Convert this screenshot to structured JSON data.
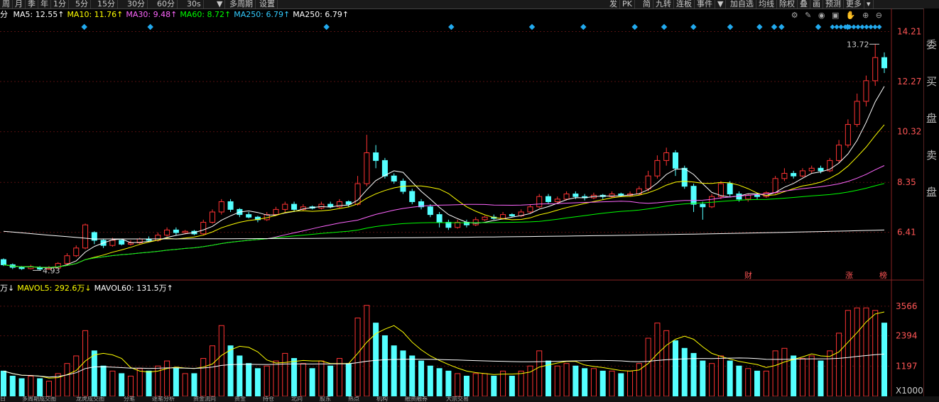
{
  "toolbar": {
    "left_buttons": [
      "周",
      "月",
      "季",
      "年",
      "1分",
      "5分",
      "15分",
      "30分",
      "60分",
      "30s",
      "▼",
      "多周期",
      "设置"
    ],
    "right_buttons": [
      "发",
      "PK",
      "简",
      "九转",
      "连板",
      "事件",
      "▼",
      "加自选",
      "均线",
      "除权",
      "叠",
      "画",
      "预测",
      "更多",
      "▾"
    ]
  },
  "ma_legend": {
    "prefix": "分",
    "items": [
      {
        "label": "MA5: 12.55↑",
        "color": "#ffffff"
      },
      {
        "label": "MA10: 11.76↑",
        "color": "#ffff00"
      },
      {
        "label": "MA30: 9.48↑",
        "color": "#ff66ff"
      },
      {
        "label": "MA60: 8.72↑",
        "color": "#00ff00"
      },
      {
        "label": "MA250: 6.79↑",
        "color": "#33ccff"
      },
      {
        "label": "MA250: 6.79↑",
        "color": "#ffffff"
      }
    ]
  },
  "vol_legend": {
    "items": [
      {
        "label": "万↓",
        "color": "#ffffff"
      },
      {
        "label": "MAVOL5: 292.6万↓",
        "color": "#ffff00"
      },
      {
        "label": "MAVOL60: 131.5万↑",
        "color": "#ffffff"
      }
    ]
  },
  "price_axis": [
    "14.21",
    "12.27",
    "10.32",
    "8.35",
    "6.41"
  ],
  "volume_axis": [
    "3566",
    "2394",
    "1197",
    "X1000"
  ],
  "annotations": {
    "high": "13.72",
    "low": "4.93",
    "events": [
      "财",
      "涨",
      "榜"
    ]
  },
  "side_panel": [
    "委",
    "买",
    "盘",
    "卖",
    "盘"
  ],
  "bottom_tabs": [
    "日",
    "多周期成交图",
    "龙虎成交图",
    "分笔",
    "逐笔分析",
    "资金流向",
    "资金",
    "持仓",
    "北向",
    "股东",
    "热点",
    "机构",
    "融资融券",
    "大宗交易"
  ],
  "chart_data": {
    "type": "candlestick",
    "price_range": [
      4.5,
      14.5
    ],
    "volume_max": 3900,
    "candles": [
      [
        5.35,
        5.15,
        5.4,
        5.1,
        1
      ],
      [
        5.15,
        5.05,
        5.2,
        4.98,
        0.8
      ],
      [
        5.05,
        5.0,
        5.1,
        4.95,
        0.7
      ],
      [
        5.0,
        5.08,
        5.15,
        4.97,
        0.8
      ],
      [
        5.05,
        4.98,
        5.1,
        4.93,
        0.7
      ],
      [
        4.98,
        5.02,
        5.1,
        4.95,
        0.6
      ],
      [
        5.02,
        5.2,
        5.25,
        5.0,
        0.9
      ],
      [
        5.2,
        5.5,
        5.6,
        5.15,
        1.3
      ],
      [
        5.5,
        5.8,
        5.9,
        5.45,
        1.6
      ],
      [
        5.8,
        6.7,
        6.75,
        5.75,
        2.6
      ],
      [
        6.4,
        6.1,
        6.45,
        5.95,
        1.8
      ],
      [
        6.1,
        5.9,
        6.15,
        5.8,
        1.2
      ],
      [
        5.9,
        6.1,
        6.2,
        5.85,
        1.0
      ],
      [
        6.1,
        5.95,
        6.15,
        5.9,
        0.9
      ],
      [
        5.95,
        6.0,
        6.1,
        5.9,
        0.8
      ],
      [
        6.0,
        6.15,
        6.2,
        5.95,
        1.1
      ],
      [
        6.15,
        6.1,
        6.25,
        6.05,
        1.0
      ],
      [
        6.1,
        6.3,
        6.4,
        6.05,
        1.2
      ],
      [
        6.3,
        6.5,
        6.6,
        6.25,
        1.4
      ],
      [
        6.5,
        6.4,
        6.6,
        6.3,
        1.1
      ],
      [
        6.4,
        6.45,
        6.5,
        6.35,
        0.9
      ],
      [
        6.45,
        6.35,
        6.5,
        6.3,
        0.9
      ],
      [
        6.35,
        6.8,
        6.9,
        6.3,
        1.5
      ],
      [
        6.8,
        7.2,
        7.3,
        6.75,
        2.0
      ],
      [
        7.2,
        7.6,
        7.7,
        7.1,
        2.8
      ],
      [
        7.6,
        7.3,
        7.7,
        7.2,
        2.0
      ],
      [
        7.3,
        7.1,
        7.35,
        7.0,
        1.6
      ],
      [
        7.1,
        7.0,
        7.2,
        6.95,
        1.3
      ],
      [
        7.0,
        6.9,
        7.05,
        6.8,
        1.1
      ],
      [
        6.9,
        7.1,
        7.2,
        6.85,
        1.2
      ],
      [
        7.1,
        7.3,
        7.4,
        7.05,
        1.4
      ],
      [
        7.3,
        7.5,
        7.6,
        7.2,
        1.7
      ],
      [
        7.5,
        7.3,
        7.6,
        7.2,
        1.5
      ],
      [
        7.3,
        7.4,
        7.5,
        7.25,
        1.3
      ],
      [
        7.4,
        7.35,
        7.45,
        7.3,
        1.1
      ],
      [
        7.35,
        7.5,
        7.6,
        7.3,
        1.4
      ],
      [
        7.5,
        7.4,
        7.6,
        7.35,
        1.2
      ],
      [
        7.4,
        7.6,
        7.7,
        7.35,
        1.5
      ],
      [
        7.6,
        7.5,
        7.65,
        7.4,
        1.3
      ],
      [
        7.5,
        8.3,
        8.6,
        7.45,
        3.1
      ],
      [
        8.3,
        9.5,
        10.2,
        8.2,
        3.6
      ],
      [
        9.5,
        9.2,
        9.8,
        8.9,
        2.9
      ],
      [
        9.2,
        8.6,
        9.3,
        8.5,
        2.4
      ],
      [
        8.6,
        8.4,
        8.7,
        8.3,
        2.0
      ],
      [
        8.4,
        8.0,
        8.5,
        7.9,
        1.8
      ],
      [
        8.0,
        7.6,
        8.1,
        7.5,
        1.6
      ],
      [
        7.6,
        7.4,
        7.7,
        7.3,
        1.4
      ],
      [
        7.4,
        7.1,
        7.5,
        7.0,
        1.2
      ],
      [
        7.1,
        6.8,
        7.2,
        6.6,
        1.1
      ],
      [
        6.8,
        6.6,
        6.9,
        6.5,
        1.0
      ],
      [
        6.6,
        6.8,
        6.9,
        6.55,
        0.9
      ],
      [
        6.8,
        6.7,
        6.9,
        6.6,
        0.8
      ],
      [
        6.7,
        6.9,
        7.0,
        6.65,
        0.9
      ],
      [
        6.9,
        7.0,
        7.05,
        6.85,
        0.9
      ],
      [
        7.0,
        6.95,
        7.1,
        6.9,
        0.8
      ],
      [
        6.95,
        7.1,
        7.2,
        6.9,
        1.0
      ],
      [
        7.1,
        7.05,
        7.15,
        7.0,
        0.8
      ],
      [
        7.05,
        7.2,
        7.3,
        7.0,
        1.0
      ],
      [
        7.2,
        7.4,
        7.5,
        7.15,
        1.2
      ],
      [
        7.4,
        7.8,
        7.9,
        7.35,
        1.8
      ],
      [
        7.8,
        7.6,
        7.9,
        7.5,
        1.4
      ],
      [
        7.6,
        7.7,
        7.8,
        7.55,
        1.2
      ],
      [
        7.7,
        7.9,
        8.0,
        7.65,
        1.3
      ],
      [
        7.9,
        7.8,
        8.0,
        7.7,
        1.2
      ],
      [
        7.8,
        7.75,
        7.9,
        7.65,
        1.1
      ],
      [
        7.75,
        7.85,
        7.95,
        7.7,
        1.1
      ],
      [
        7.85,
        7.8,
        7.9,
        7.7,
        1.0
      ],
      [
        7.8,
        7.9,
        8.0,
        7.75,
        1.0
      ],
      [
        7.9,
        7.85,
        7.95,
        7.8,
        0.9
      ],
      [
        7.85,
        7.9,
        8.0,
        7.8,
        1.0
      ],
      [
        7.9,
        8.1,
        8.2,
        7.85,
        1.3
      ],
      [
        8.1,
        8.6,
        8.8,
        8.0,
        2.3
      ],
      [
        8.6,
        9.2,
        9.4,
        8.5,
        2.9
      ],
      [
        9.2,
        9.5,
        9.7,
        9.0,
        2.6
      ],
      [
        9.5,
        8.9,
        9.6,
        8.6,
        2.2
      ],
      [
        8.9,
        8.2,
        9.0,
        8.1,
        1.9
      ],
      [
        8.2,
        7.5,
        8.3,
        7.2,
        1.7
      ],
      [
        7.5,
        7.4,
        7.6,
        6.9,
        1.4
      ],
      [
        7.4,
        7.8,
        7.9,
        7.35,
        1.3
      ],
      [
        7.8,
        8.3,
        8.4,
        7.7,
        1.6
      ],
      [
        8.3,
        7.9,
        8.4,
        7.8,
        1.4
      ],
      [
        7.9,
        7.7,
        8.0,
        7.6,
        1.2
      ],
      [
        7.7,
        7.85,
        7.9,
        7.6,
        1.1
      ],
      [
        7.85,
        7.8,
        7.95,
        7.7,
        1.0
      ],
      [
        7.8,
        7.95,
        8.0,
        7.75,
        1.0
      ],
      [
        7.95,
        8.5,
        8.6,
        7.9,
        1.8
      ],
      [
        8.5,
        8.7,
        8.9,
        8.4,
        1.9
      ],
      [
        8.7,
        8.6,
        8.8,
        8.5,
        1.6
      ],
      [
        8.6,
        8.8,
        8.9,
        8.55,
        1.5
      ],
      [
        8.8,
        8.9,
        9.0,
        8.7,
        1.6
      ],
      [
        8.9,
        8.8,
        9.0,
        8.7,
        1.4
      ],
      [
        8.8,
        9.2,
        9.3,
        8.75,
        1.8
      ],
      [
        9.2,
        9.8,
        10.0,
        9.1,
        2.5
      ],
      [
        9.8,
        10.6,
        10.8,
        9.7,
        3.4
      ],
      [
        10.6,
        11.5,
        11.8,
        10.5,
        3.5
      ],
      [
        11.5,
        12.3,
        12.5,
        11.3,
        3.5
      ],
      [
        12.3,
        13.2,
        13.72,
        12.1,
        3.4
      ],
      [
        13.2,
        12.8,
        13.4,
        12.6,
        2.9
      ]
    ]
  }
}
